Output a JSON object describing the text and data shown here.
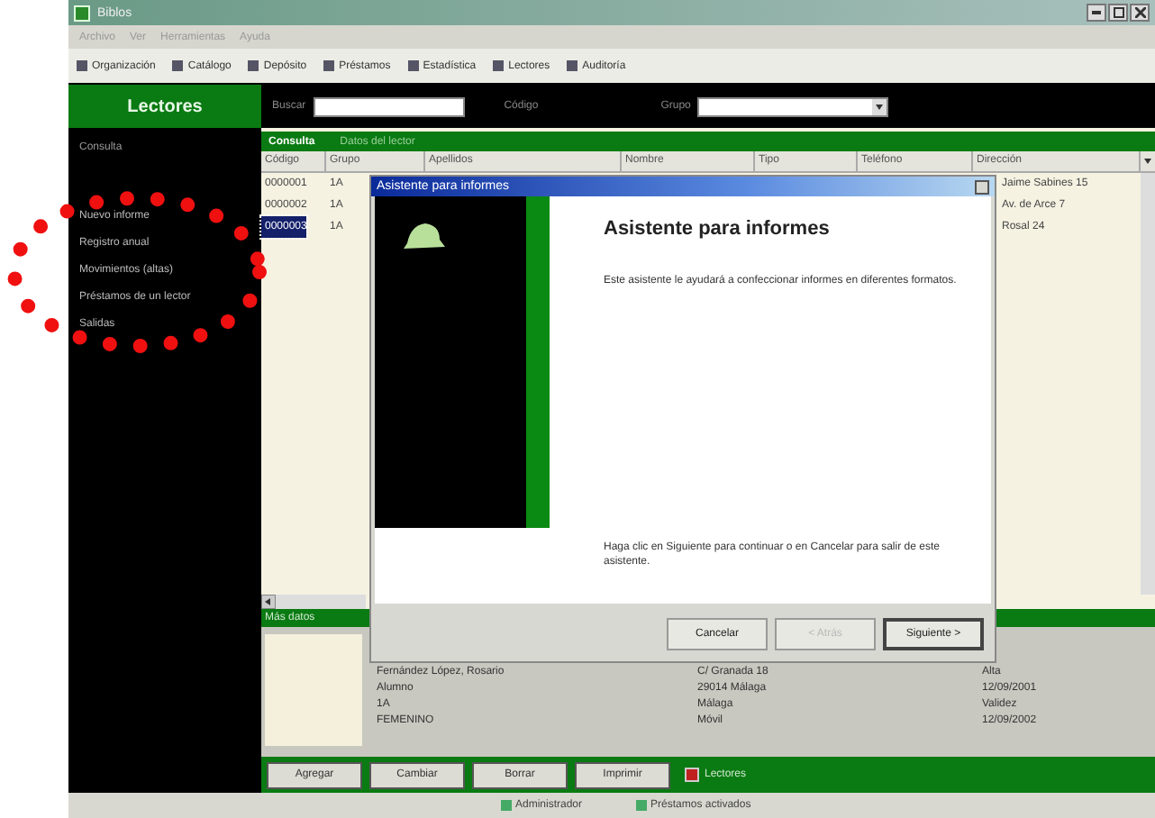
{
  "window": {
    "title": "Biblos"
  },
  "menu": [
    "Archivo",
    "Ver",
    "Herramientas",
    "Ayuda"
  ],
  "toolbar": [
    "Organización",
    "Catálogo",
    "Depósito",
    "Préstamos",
    "Estadística",
    "Lectores",
    "Auditoría"
  ],
  "header": {
    "section": "Lectores",
    "filters": [
      {
        "label": "Buscar",
        "kind": "field"
      },
      {
        "label": "Código",
        "kind": "text"
      },
      {
        "label": "Grupo",
        "kind": "combo"
      }
    ]
  },
  "sidebar": {
    "title": "Consulta",
    "items": [
      "Nuevo informe",
      "Registro anual",
      "Movimientos (altas)",
      "Préstamos de un lector",
      "Salidas"
    ]
  },
  "tabs": [
    {
      "label": "Consulta",
      "selected": true
    },
    {
      "label": "Datos del lector",
      "selected": false
    }
  ],
  "table": {
    "columns": [
      "Código",
      "Grupo",
      "Apellidos",
      "Nombre",
      "Tipo",
      "Teléfono",
      "Dirección"
    ],
    "rows": [
      {
        "codigo": "0000001",
        "grupo": "1A",
        "direccion": "Jaime Sabines 15",
        "selected": false
      },
      {
        "codigo": "0000002",
        "grupo": "1A",
        "direccion": "Av. de Arce 7",
        "selected": false
      },
      {
        "codigo": "0000003",
        "grupo": "1A",
        "direccion": "Rosal 24",
        "selected": true
      }
    ]
  },
  "details": {
    "bar": "Más datos",
    "lines": [
      [
        "Fernández López, Rosario",
        "C/ Granada 18",
        "Alta"
      ],
      [
        "Alumno",
        "29014   Málaga",
        "12/09/2001"
      ],
      [
        "1A",
        "Málaga",
        "Validez"
      ],
      [
        "FEMENINO",
        "Móvil",
        "12/09/2002"
      ]
    ]
  },
  "actions": [
    "Agregar",
    "Cambiar",
    "Borrar",
    "Imprimir"
  ],
  "actions_check": {
    "label": "Lectores",
    "checked": true
  },
  "status_bar": [
    "Administrador",
    "Préstamos activados"
  ],
  "dialog": {
    "title": "Asistente para informes",
    "heading": "Asistente para informes",
    "intro": "Este asistente le ayudará a confeccionar informes en diferentes formatos.",
    "footer": "Haga clic en Siguiente para continuar o en Cancelar para salir de este asistente.",
    "buttons": [
      {
        "label": "Cancelar",
        "disabled": false
      },
      {
        "label": "< Atrás",
        "disabled": true
      },
      {
        "label": "Siguiente >",
        "disabled": false
      }
    ]
  }
}
